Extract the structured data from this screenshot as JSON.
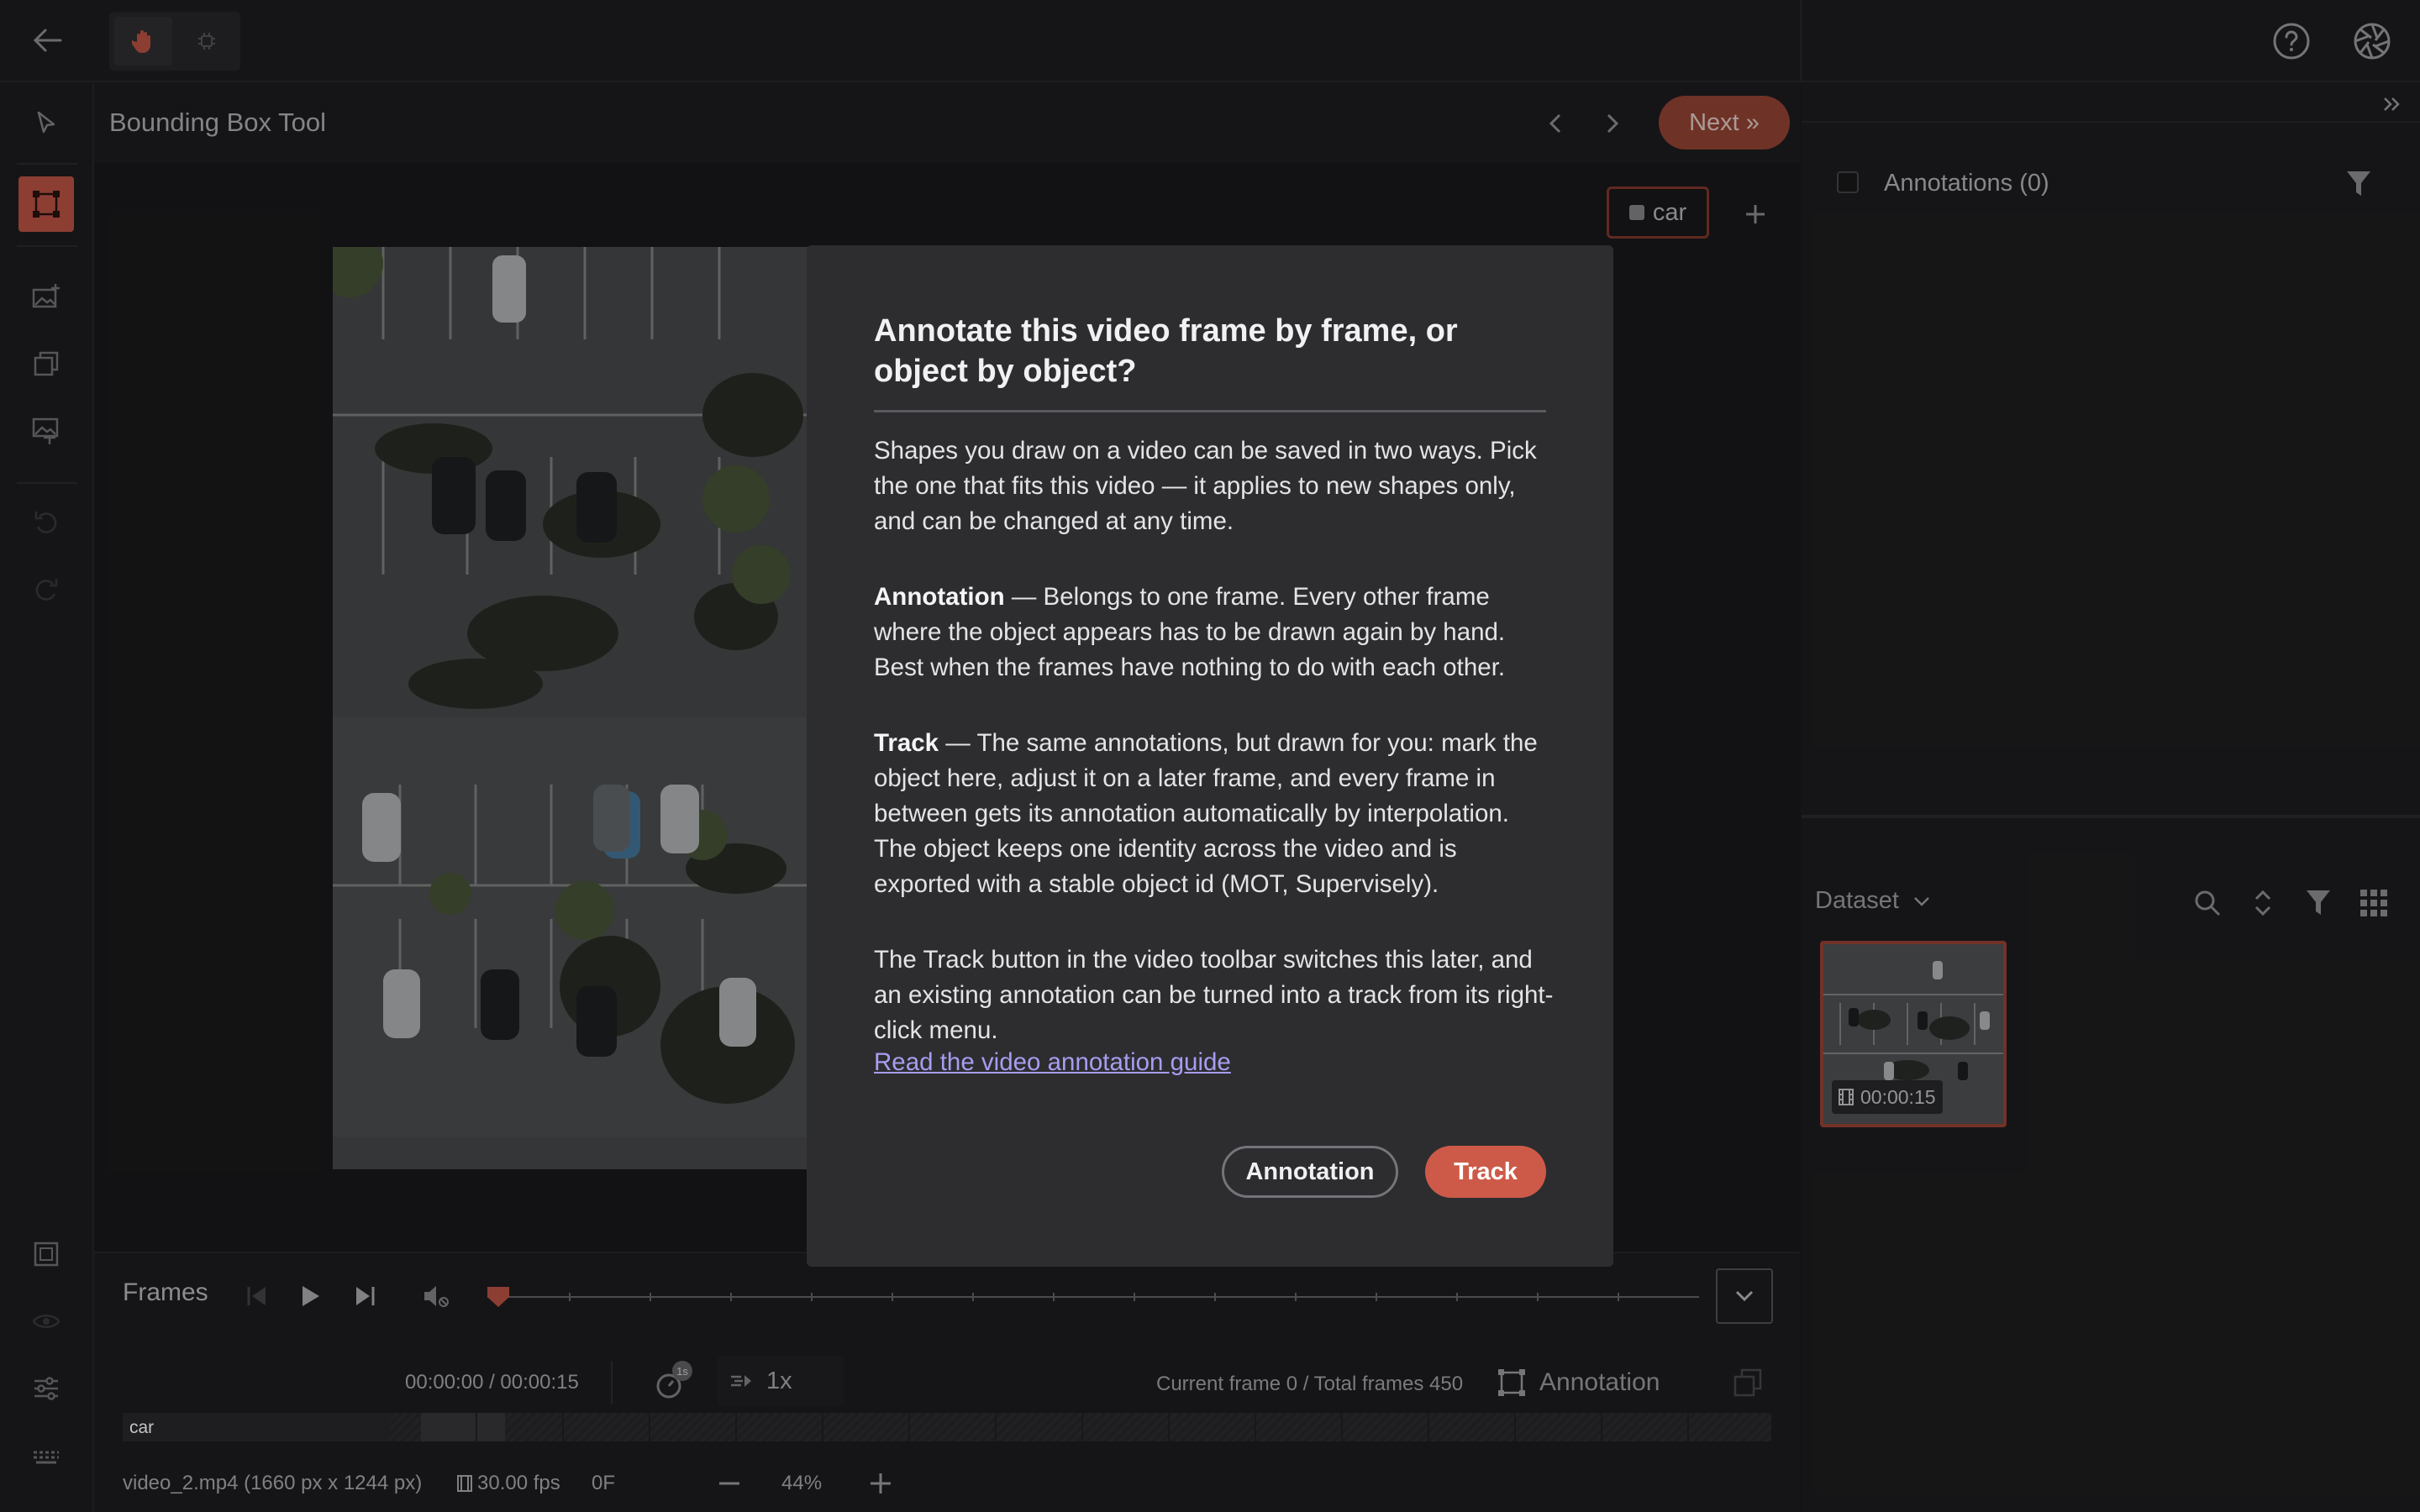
{
  "topbar": {
    "back_icon": "arrow-left-icon",
    "modes": [
      {
        "name": "pan-mode",
        "icon": "hand-icon",
        "active": true
      },
      {
        "name": "ai-mode",
        "icon": "chip-icon",
        "active": false
      }
    ],
    "help_icon": "help-circle-icon",
    "logo_icon": "aperture-logo-icon"
  },
  "tools": [
    {
      "icon": "cursor-icon",
      "active": false
    },
    {
      "icon": "bounding-box-icon",
      "active": true
    },
    {
      "icon": "image-add-icon",
      "active": false
    },
    {
      "icon": "layers-icon",
      "active": false
    },
    {
      "icon": "image-text-icon",
      "active": false
    },
    {
      "icon": "undo-icon",
      "active": false
    },
    {
      "icon": "redo-icon",
      "active": false
    },
    {
      "icon": "fit-screen-icon",
      "active": false
    },
    {
      "icon": "eye-icon",
      "active": false
    },
    {
      "icon": "sliders-icon",
      "active": false
    },
    {
      "icon": "keyboard-icon",
      "active": false
    }
  ],
  "header": {
    "tool_title": "Bounding Box Tool",
    "next_label": "Next »"
  },
  "canvas": {
    "label_chip": "car",
    "accent_color": "#c9594a"
  },
  "player": {
    "frames_label": "Frames",
    "time": "00:00:00 / 00:00:15",
    "speed_badge": "1s",
    "speed": "1x",
    "frame_counter": "Current frame 0 / Total frames 450",
    "mode_label": "Annotation",
    "track_label": "car",
    "file_info": "video_2.mp4 (1660 px x 1244 px)",
    "fps": "30.00 fps",
    "frame_offset": "0F",
    "zoom": "44%"
  },
  "right_panel": {
    "annotations_title": "Annotations (0)",
    "dataset_label": "Dataset",
    "thumb_duration": "00:00:15"
  },
  "modal": {
    "title": "Annotate this video frame by frame, or object by object?",
    "intro": "Shapes you draw on a video can be saved in two ways. Pick the one that fits this video — it applies to new shapes only, and can be changed at any time.",
    "annotation_term": "Annotation",
    "annotation_desc": " — Belongs to one frame. Every other frame where the object appears has to be drawn again by hand. Best when the frames have nothing to do with each other.",
    "track_term": "Track",
    "track_desc": " — The same annotations, but drawn for you: mark the object here, adjust it on a later frame, and every frame in between gets its annotation automatically by interpolation. The object keeps one identity across the video and is exported with a stable object id (MOT, Supervisely).",
    "note": "The Track button in the video toolbar switches this later, and an existing annotation can be turned into a track from its right-click menu.",
    "guide_link": "Read the video annotation guide",
    "btn_annotation": "Annotation",
    "btn_track": "Track"
  }
}
